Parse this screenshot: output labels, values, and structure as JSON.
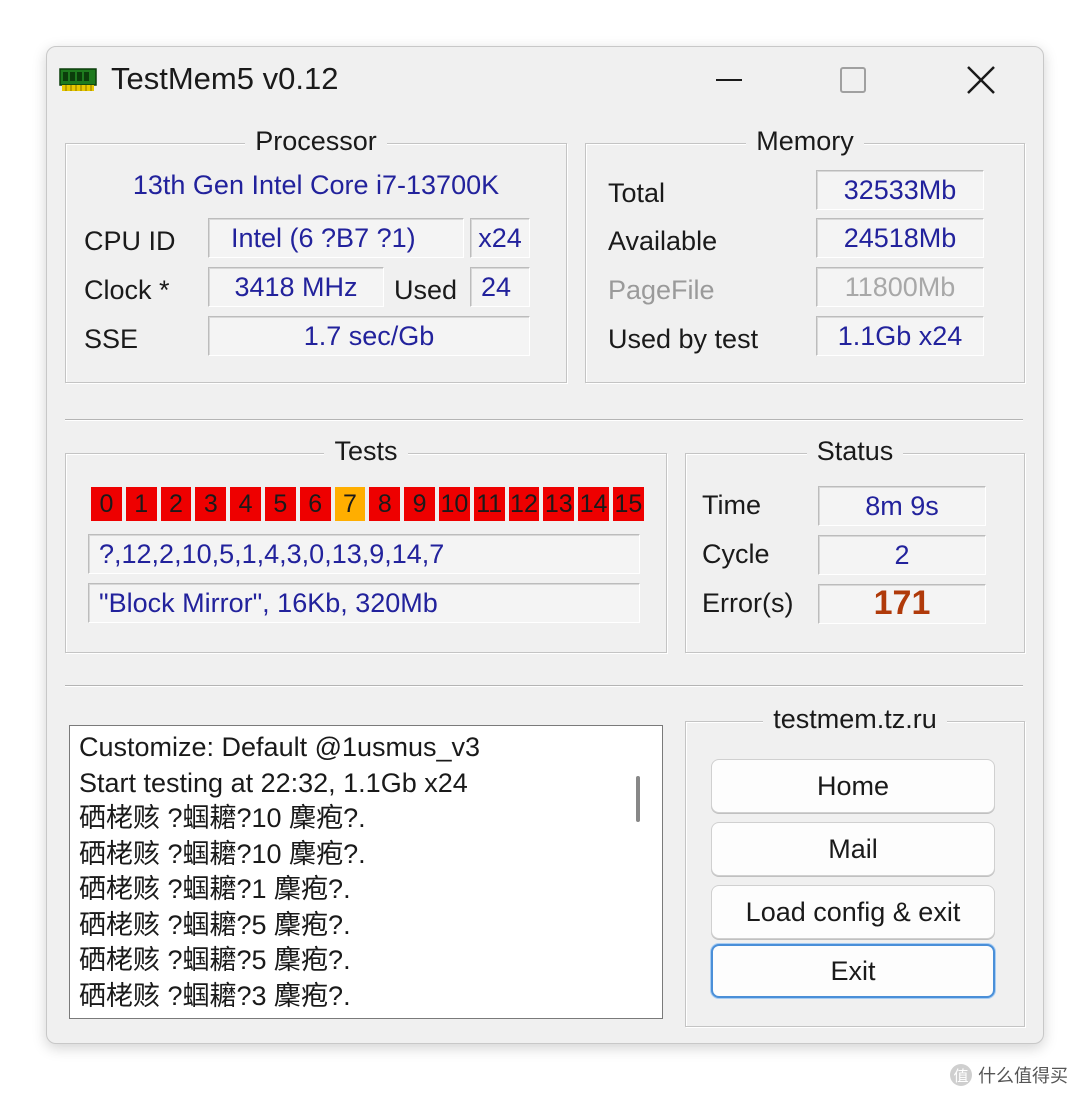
{
  "window": {
    "title": "TestMem5 v0.12",
    "controls": {
      "minimize": "minimize-icon",
      "maximize": "maximize-icon",
      "close": "close-icon"
    }
  },
  "processor": {
    "title": "Processor",
    "name": "13th Gen Intel Core i7-13700K",
    "cpu_id_label": "CPU ID",
    "cpu_id_value": "Intel  (6 ?B7 ?1)",
    "threads_value": "x24",
    "clock_label": "Clock *",
    "clock_value": "3418 MHz",
    "used_label": "Used",
    "used_value": "24",
    "sse_label": "SSE",
    "sse_value": "1.7 sec/Gb"
  },
  "memory": {
    "title": "Memory",
    "total_label": "Total",
    "total_value": "32533Mb",
    "available_label": "Available",
    "available_value": "24518Mb",
    "pagefile_label": "PageFile",
    "pagefile_value": "11800Mb",
    "used_by_test_label": "Used by test",
    "used_by_test_value": "1.1Gb x24"
  },
  "tests": {
    "title": "Tests",
    "cells": [
      "0",
      "1",
      "2",
      "3",
      "4",
      "5",
      "6",
      "7",
      "8",
      "9",
      "10",
      "11",
      "12",
      "13",
      "14",
      "15"
    ],
    "current_index": 7,
    "sequence": "?,12,2,10,5,1,4,3,0,13,9,14,7",
    "current_test": "\"Block Mirror\", 16Kb, 320Mb",
    "colors": {
      "done": "#ee0000",
      "current": "#ffae00"
    }
  },
  "status": {
    "title": "Status",
    "time_label": "Time",
    "time_value": "8m 9s",
    "cycle_label": "Cycle",
    "cycle_value": "2",
    "errors_label": "Error(s)",
    "errors_value": "171"
  },
  "log": {
    "lines": [
      "Customize: Default @1usmus_v3",
      "Start testing at 22:32, 1.1Gb x24",
      "硒栳赅 ?蝈耱?10 麇疱?.",
      "硒栳赅 ?蝈耱?10 麇疱?.",
      "硒栳赅 ?蝈耱?1 麇疱?.",
      "硒栳赅 ?蝈耱?5 麇疱?.",
      "硒栳赅 ?蝈耱?5 麇疱?.",
      "硒栳赅 ?蝈耱?3 麇疱?."
    ]
  },
  "links": {
    "title": "testmem.tz.ru",
    "home_label": "Home",
    "mail_label": "Mail",
    "load_config_label": "Load config & exit",
    "exit_label": "Exit"
  },
  "watermark": {
    "text": "什么值得买"
  }
}
